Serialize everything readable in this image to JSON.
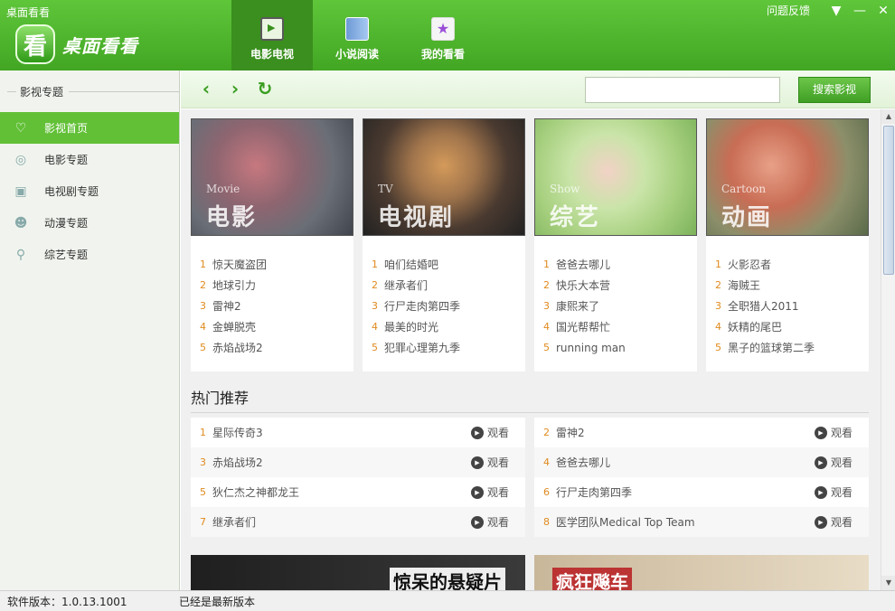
{
  "window": {
    "title": "桌面看看"
  },
  "logo": {
    "badge": "看",
    "text": "桌面看看"
  },
  "nav": {
    "tabs": [
      {
        "label": "电影电视",
        "icon": "film-icon",
        "active": true
      },
      {
        "label": "小说阅读",
        "icon": "book-icon",
        "active": false
      },
      {
        "label": "我的看看",
        "icon": "star-icon",
        "active": false
      }
    ]
  },
  "top_right": {
    "feedback": "问题反馈",
    "menu_icon": "▼",
    "min_icon": "—",
    "close_icon": "✕"
  },
  "sidebar": {
    "header": "影视专题",
    "items": [
      {
        "label": "影视首页",
        "icon": "heart-icon",
        "active": true
      },
      {
        "label": "电影专题",
        "icon": "film-reel-icon",
        "active": false
      },
      {
        "label": "电视剧专题",
        "icon": "tv-icon",
        "active": false
      },
      {
        "label": "动漫专题",
        "icon": "cartoon-icon",
        "active": false
      },
      {
        "label": "综艺专题",
        "icon": "magnifier-icon",
        "active": false
      }
    ]
  },
  "toolbar": {
    "back": "‹",
    "forward": "›",
    "refresh": "↻",
    "search_value": "",
    "search_button": "搜索影视"
  },
  "cards": [
    {
      "en": "Movie",
      "zh": "电影",
      "items": [
        "惊天魔盗团",
        "地球引力",
        "雷神2",
        "金蝉脱壳",
        "赤焰战场2"
      ]
    },
    {
      "en": "TV",
      "zh": "电视剧",
      "items": [
        "咱们结婚吧",
        "继承者们",
        "行尸走肉第四季",
        "最美的时光",
        "犯罪心理第九季"
      ]
    },
    {
      "en": "Show",
      "zh": "综艺",
      "items": [
        "爸爸去哪儿",
        "快乐大本营",
        "康熙来了",
        "国光帮帮忙",
        "running man"
      ]
    },
    {
      "en": "Cartoon",
      "zh": "动画",
      "items": [
        "火影忍者",
        "海贼王",
        "全职猎人2011",
        "妖精的尾巴",
        "黑子的篮球第二季"
      ]
    }
  ],
  "hot": {
    "title": "热门推荐",
    "watch_label": "观看",
    "items": [
      {
        "n": "1",
        "title": "星际传奇3"
      },
      {
        "n": "2",
        "title": "雷神2"
      },
      {
        "n": "3",
        "title": "赤焰战场2"
      },
      {
        "n": "4",
        "title": "爸爸去哪儿"
      },
      {
        "n": "5",
        "title": "狄仁杰之神都龙王"
      },
      {
        "n": "6",
        "title": "行尸走肉第四季"
      },
      {
        "n": "7",
        "title": "继承者们"
      },
      {
        "n": "8",
        "title": "医学团队Medical Top Team"
      }
    ]
  },
  "banners": [
    {
      "text": "惊呆的悬疑片"
    },
    {
      "text": "疯狂飚车"
    }
  ],
  "status": {
    "version": "软件版本：1.0.13.1001",
    "update": "已经是最新版本"
  }
}
